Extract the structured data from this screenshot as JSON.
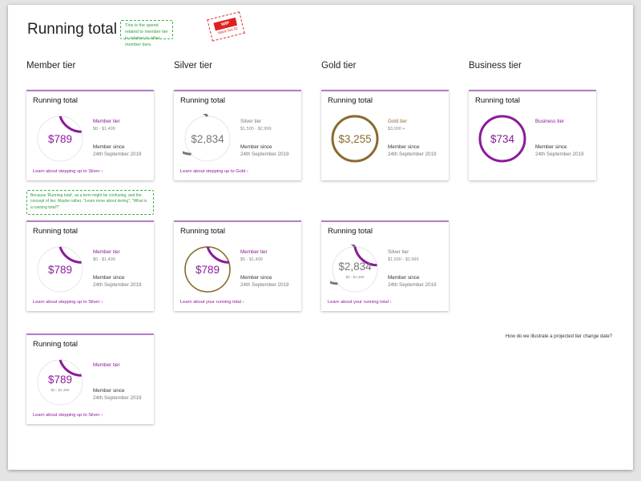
{
  "page": {
    "title": "Running total",
    "note_top": "This is the spend related to member tier in relation to other member tiers.",
    "note_mid": "Because 'Running total', as a term might be confusing, and the concept of tier. Maybe rather, \"Learn more about tiering\", \"What is a running total?\"",
    "wip": {
      "label": "WIP",
      "sub": "Ward Swi 02"
    },
    "question": "How do we illustrate a projected tier change date?"
  },
  "colors": {
    "purple": "#8b1a9a",
    "grey": "#777777",
    "gold": "#8a6a2e",
    "track": "#e6e6ea"
  },
  "tier_headings": [
    "Member tier",
    "Silver tier",
    "Gold tier",
    "Business tier"
  ],
  "cards": [
    {
      "title": "Running total",
      "value": "$789",
      "value_color": "purple",
      "tier_name": "Member tier",
      "tier_color": "purple",
      "tier_range": "$0 - $1,499",
      "ring_sub": "",
      "since_label": "Member since",
      "since_date": "24th September 2019",
      "link": "Learn about stepping up to Silver",
      "progress": 0.2,
      "arc_color": "purple",
      "second_progress": 0,
      "second_color": "grey"
    },
    {
      "title": "Running total",
      "value": "$2,834",
      "value_color": "grey",
      "tier_name": "Silver tier",
      "tier_color": "grey",
      "tier_range": "$1,500 - $2,999",
      "ring_sub": "",
      "since_label": "Member since",
      "since_date": "24th September 2019",
      "link": "Learn about stepping up to Gold",
      "progress": 0.63,
      "arc_color": "grey",
      "second_progress": 0,
      "second_color": "grey"
    },
    {
      "title": "Running total",
      "value": "$3,255",
      "value_color": "gold",
      "tier_name": "Gold tier",
      "tier_color": "gold",
      "tier_range": "$3,000 +",
      "ring_sub": "",
      "since_label": "Member since",
      "since_date": "24th September 2019",
      "link": "",
      "progress": 1,
      "arc_color": "gold",
      "second_progress": 0,
      "second_color": "grey"
    },
    {
      "title": "Running total",
      "value": "$734",
      "value_color": "purple",
      "tier_name": "Business tier",
      "tier_color": "purple",
      "tier_range": "",
      "ring_sub": "",
      "since_label": "Member since",
      "since_date": "24th September 2019",
      "link": "",
      "progress": 1,
      "arc_color": "purple",
      "second_progress": 0,
      "second_color": "grey"
    },
    {
      "title": "Running total",
      "value": "$789",
      "value_color": "purple",
      "tier_name": "Member tier",
      "tier_color": "purple",
      "tier_range": "$0 - $1,499",
      "ring_sub": "",
      "since_label": "Member since",
      "since_date": "24th September 2019",
      "link": "Learn about stepping up to Silver",
      "progress": 0.2,
      "arc_color": "purple",
      "second_progress": 0,
      "second_color": "grey"
    },
    {
      "title": "Running total",
      "value": "$789",
      "value_color": "purple",
      "tier_name": "Member tier",
      "tier_color": "purple",
      "tier_range": "$0 - $1,499",
      "ring_sub": "",
      "since_label": "Member since",
      "since_date": "24th September 2019",
      "link": "Learn about your running total",
      "progress": 0.2,
      "arc_color": "purple",
      "second_progress": 0,
      "second_color": "grey",
      "full_track_color": "gold"
    },
    {
      "title": "Running total",
      "value": "$2,834",
      "value_color": "grey",
      "tier_name": "Silver tier",
      "tier_color": "grey",
      "tier_range": "$1,500 - $2,999",
      "ring_sub": "$0 - $1,499",
      "since_label": "Member since",
      "since_date": "24th September 2019",
      "link": "Learn about your running total",
      "progress": 0.22,
      "arc_color": "purple",
      "second_progress": 0.42,
      "second_color": "grey"
    },
    {
      "title": "Running total",
      "value": "$789",
      "value_color": "purple",
      "tier_name": "Member tier",
      "tier_color": "purple",
      "tier_range": "",
      "ring_sub": "$0 - $1,499",
      "since_label": "Member since",
      "since_date": "24th September 2019",
      "link": "Learn about stepping up to Silver",
      "progress": 0.2,
      "arc_color": "purple",
      "second_progress": 0,
      "second_color": "grey"
    }
  ]
}
